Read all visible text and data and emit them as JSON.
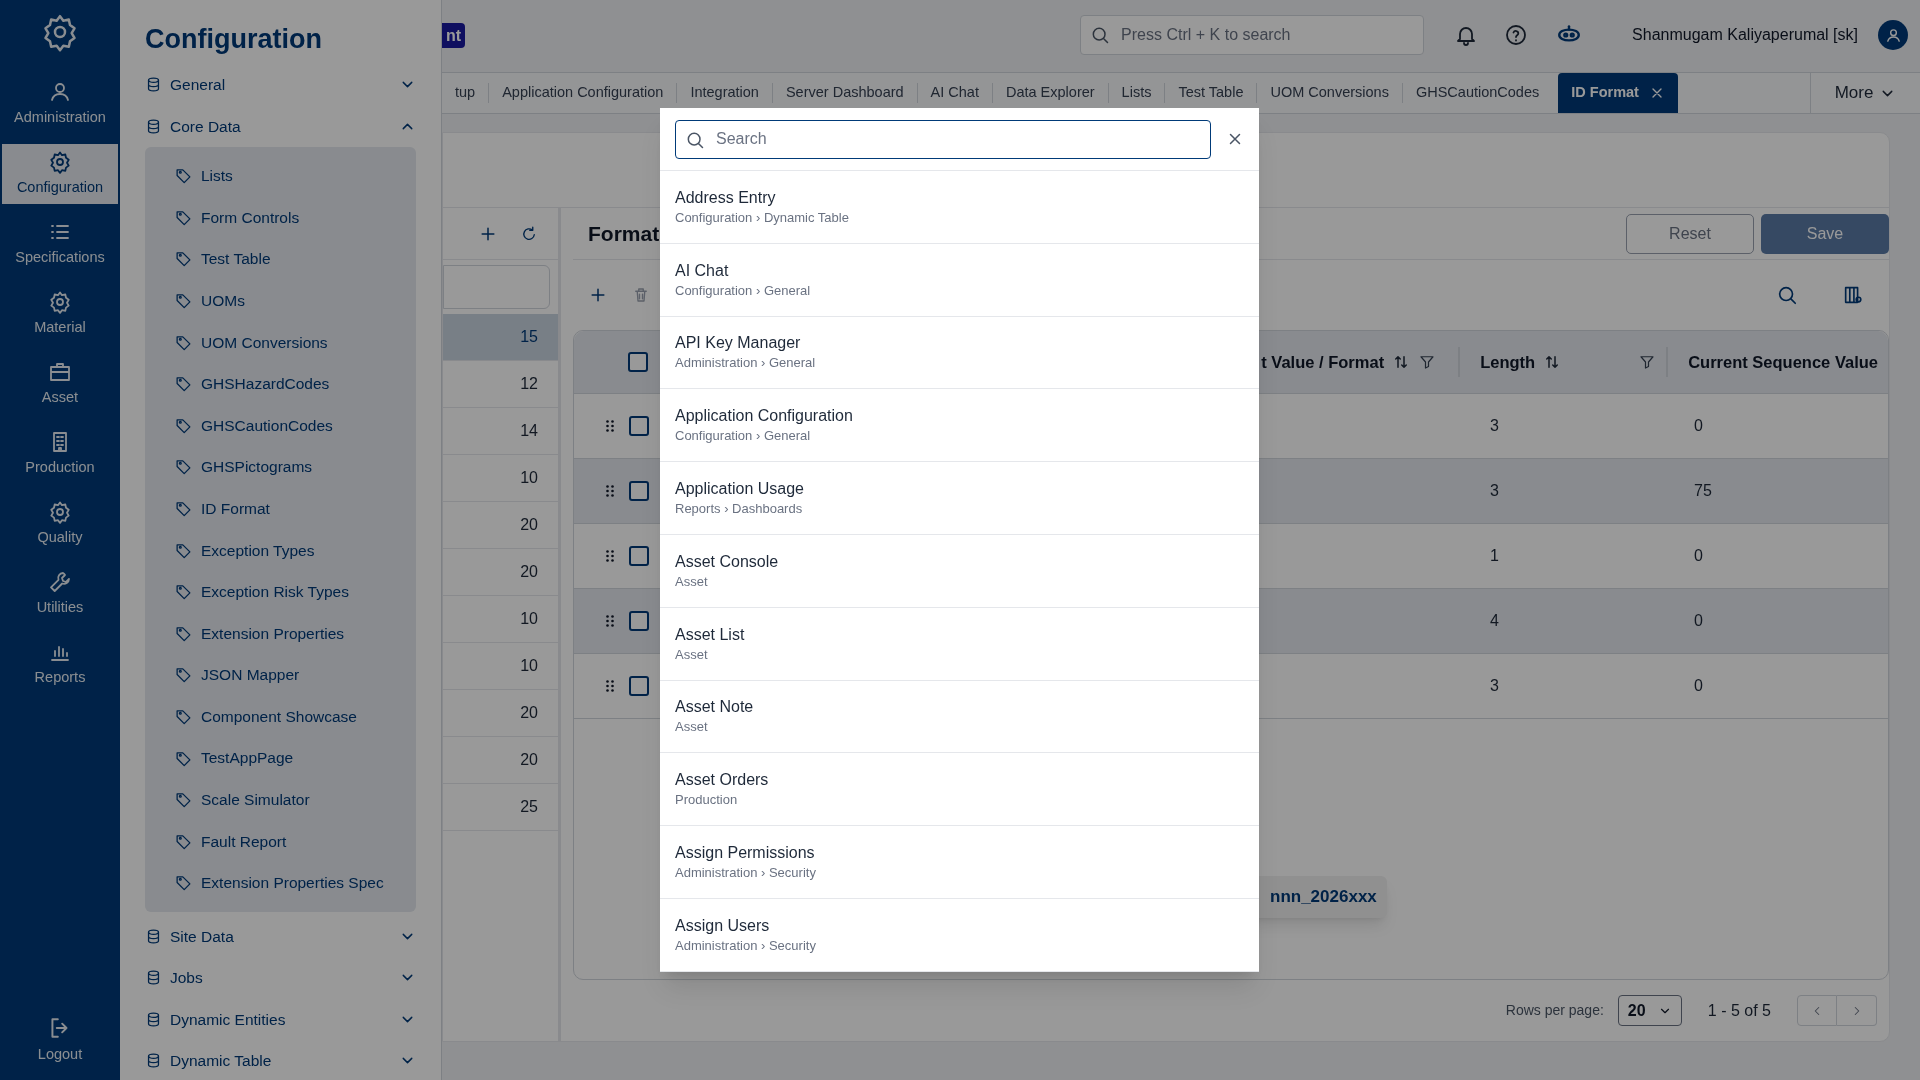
{
  "rail": {
    "items": [
      {
        "label": "Administration",
        "selected": false
      },
      {
        "label": "Configuration",
        "selected": true
      },
      {
        "label": "Specifications",
        "selected": false
      },
      {
        "label": "Material",
        "selected": false
      },
      {
        "label": "Asset",
        "selected": false
      },
      {
        "label": "Production",
        "selected": false
      },
      {
        "label": "Quality",
        "selected": false
      },
      {
        "label": "Utilities",
        "selected": false
      },
      {
        "label": "Reports",
        "selected": false
      }
    ],
    "logout": "Logout"
  },
  "config_panel": {
    "title": "Configuration",
    "sections": [
      {
        "label": "General",
        "expanded": false
      },
      {
        "label": "Core Data",
        "expanded": true,
        "children": [
          "Lists",
          "Form Controls",
          "Test Table",
          "UOMs",
          "UOM Conversions",
          "GHSHazardCodes",
          "GHSCautionCodes",
          "GHSPictograms",
          "ID Format",
          "Exception Types",
          "Exception Risk Types",
          "Extension Properties",
          "JSON Mapper",
          "Component Showcase",
          "TestAppPage",
          "Scale Simulator",
          "Fault Report",
          "Extension Properties Spec"
        ]
      },
      {
        "label": "Site Data",
        "expanded": false
      },
      {
        "label": "Jobs",
        "expanded": false
      },
      {
        "label": "Dynamic Entities",
        "expanded": false
      },
      {
        "label": "Dynamic Table",
        "expanded": false
      }
    ]
  },
  "header": {
    "badge": "nt",
    "search": {
      "placeholder": "Press Ctrl + K to search"
    },
    "user": "Shanmugam Kaliyaperumal [sk]"
  },
  "tabs": [
    {
      "label": "tup",
      "selected": false
    },
    {
      "label": "Application Configuration",
      "selected": false
    },
    {
      "label": "Integration",
      "selected": false
    },
    {
      "label": "Server Dashboard",
      "selected": false
    },
    {
      "label": "AI Chat",
      "selected": false
    },
    {
      "label": "Data Explorer",
      "selected": false
    },
    {
      "label": "Lists",
      "selected": false
    },
    {
      "label": "Test Table",
      "selected": false
    },
    {
      "label": "UOM Conversions",
      "selected": false
    },
    {
      "label": "GHSCautionCodes",
      "selected": false
    },
    {
      "label": "ID Format",
      "selected": true
    }
  ],
  "more": "More",
  "list_panel": {
    "rows": [
      {
        "value": "15",
        "selected": true
      },
      {
        "value": "12",
        "selected": false
      },
      {
        "value": "14",
        "selected": false
      },
      {
        "value": "10",
        "selected": false
      },
      {
        "value": "20",
        "selected": false
      },
      {
        "value": "20",
        "selected": false
      },
      {
        "value": "10",
        "selected": false
      },
      {
        "value": "10",
        "selected": false
      },
      {
        "value": "20",
        "selected": false
      },
      {
        "value": "20",
        "selected": false
      },
      {
        "value": "25",
        "selected": false
      }
    ]
  },
  "format_panel": {
    "title": "Format",
    "buttons": [
      "Reset",
      "Save"
    ],
    "table": {
      "select_all": {
        "checked": false
      },
      "columns": [
        "t Value / Format",
        "Length",
        "Current Sequence Value"
      ],
      "rows": [
        {
          "checked": false,
          "length": "3",
          "current": "0"
        },
        {
          "checked": false,
          "length": "3",
          "current": "75"
        },
        {
          "checked": false,
          "length": "1",
          "current": "0"
        },
        {
          "checked": false,
          "length": "4",
          "current": "0"
        },
        {
          "checked": false,
          "length": "3",
          "current": "0"
        }
      ]
    },
    "tooltip": "nnn_2026xxx",
    "pagination": {
      "label": "Rows per page:",
      "page_size": "20",
      "range": "1 - 5 of 5"
    }
  },
  "search_dialog": {
    "placeholder": "Search",
    "results": [
      {
        "title": "Address Entry",
        "path": "Configuration › Dynamic Table"
      },
      {
        "title": "AI Chat",
        "path": "Configuration › General"
      },
      {
        "title": "API Key Manager",
        "path": "Administration › General"
      },
      {
        "title": "Application Configuration",
        "path": "Configuration › General"
      },
      {
        "title": "Application Usage",
        "path": "Reports › Dashboards"
      },
      {
        "title": "Asset Console",
        "path": "Asset"
      },
      {
        "title": "Asset List",
        "path": "Asset"
      },
      {
        "title": "Asset Note",
        "path": "Asset"
      },
      {
        "title": "Asset Orders",
        "path": "Production"
      },
      {
        "title": "Assign Permissions",
        "path": "Administration › Security"
      },
      {
        "title": "Assign Users",
        "path": "Administration › Security"
      }
    ]
  }
}
